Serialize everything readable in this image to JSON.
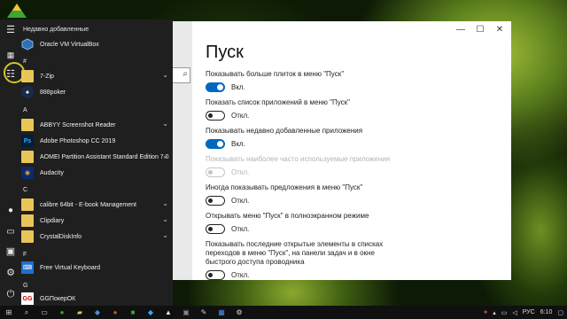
{
  "settings": {
    "title": "Пуск",
    "items": [
      {
        "label": "Показывать больше плиток в меню \"Пуск\"",
        "state": "Вкл.",
        "on": true,
        "disabled": false
      },
      {
        "label": "Показать список приложений в меню \"Пуск\"",
        "state": "Откл.",
        "on": false,
        "disabled": false
      },
      {
        "label": "Показывать недавно добавленные приложения",
        "state": "Вкл.",
        "on": true,
        "disabled": false
      },
      {
        "label": "Показывать наиболее часто используемые приложения",
        "state": "Откл.",
        "on": false,
        "disabled": true
      },
      {
        "label": "Иногда показывать предложения в меню \"Пуск\"",
        "state": "Откл.",
        "on": false,
        "disabled": false
      },
      {
        "label": "Открывать меню \"Пуск\" в полноэкранном режиме",
        "state": "Откл.",
        "on": false,
        "disabled": false
      },
      {
        "label": "Показывать последние открытые элементы в списках переходов в меню \"Пуск\", на панели задач и в окне быстрого доступа проводника",
        "state": "Откл.",
        "on": false,
        "disabled": false
      }
    ]
  },
  "start_menu": {
    "recent_header": "Недавно добавленные",
    "recent_app": "Oracle VM VirtualBox",
    "section_hash": "#",
    "apps_hash": [
      {
        "label": "7-Zip",
        "icon": "folder-icon",
        "expandable": true
      },
      {
        "label": "888poker",
        "icon": "888poker-icon",
        "expandable": false
      }
    ],
    "section_a": "A",
    "apps_a": [
      {
        "label": "ABBYY Screenshot Reader",
        "icon": "folder-icon",
        "expandable": true
      },
      {
        "label": "Adobe Photoshop CC 2019",
        "icon": "photoshop-icon",
        "expandable": false
      },
      {
        "label": "AOMEI Partition Assistant Standard Edition 7.0",
        "icon": "folder-icon",
        "expandable": true
      },
      {
        "label": "Audacity",
        "icon": "audacity-icon",
        "expandable": false
      }
    ],
    "section_c": "C",
    "apps_c": [
      {
        "label": "calibre 64bit - E-book Management",
        "icon": "folder-icon",
        "expandable": true
      },
      {
        "label": "Clipdiary",
        "icon": "folder-icon",
        "expandable": true
      },
      {
        "label": "CrystalDiskInfo",
        "icon": "folder-icon",
        "expandable": true
      }
    ],
    "section_f": "F",
    "apps_f": [
      {
        "label": "Free Virtual Keyboard",
        "icon": "keyboard-icon",
        "expandable": false
      }
    ],
    "section_g": "G",
    "apps_g": [
      {
        "label": "GGПокерОК",
        "icon": "ggpoker-icon",
        "expandable": false
      }
    ]
  },
  "taskbar": {
    "language": "РУС",
    "time": "6:10"
  },
  "colors": {
    "accent": "#0067c0",
    "folder": "#e8c657",
    "start_bg": "#1f1f1f"
  }
}
